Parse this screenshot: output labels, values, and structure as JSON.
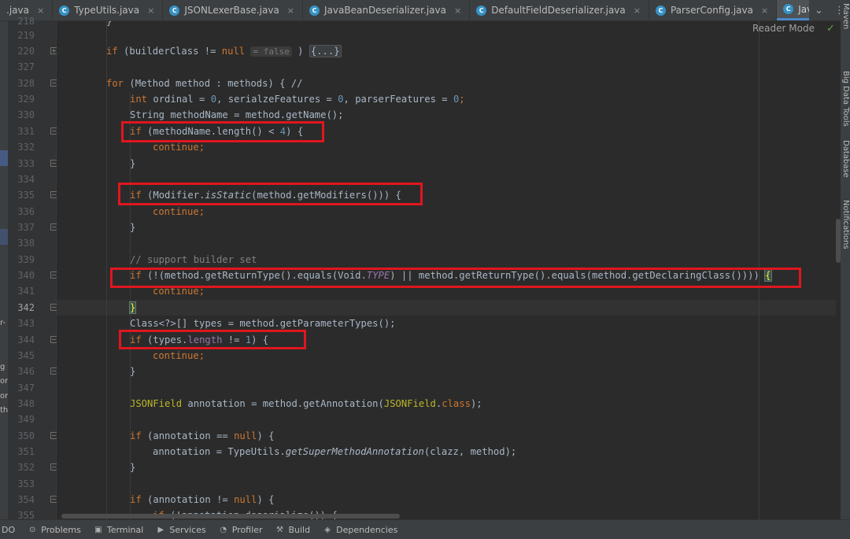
{
  "tabs": [
    {
      "label": ".java",
      "icon": false,
      "active": false
    },
    {
      "label": "TypeUtils.java",
      "icon": true,
      "active": false
    },
    {
      "label": "JSONLexerBase.java",
      "icon": true,
      "active": false
    },
    {
      "label": "JavaBeanDeserializer.java",
      "icon": true,
      "active": false
    },
    {
      "label": "DefaultFieldDeserializer.java",
      "icon": true,
      "active": false
    },
    {
      "label": "ParserConfig.java",
      "icon": true,
      "active": false
    },
    {
      "label": "JavaBeanInfo.java",
      "icon": true,
      "active": true
    }
  ],
  "tab_icon_letter": "C",
  "reader_mode_label": "Reader Mode",
  "line_numbers": [
    "218",
    "219",
    "220",
    "327",
    "328",
    "329",
    "330",
    "331",
    "332",
    "333",
    "334",
    "335",
    "336",
    "337",
    "338",
    "339",
    "340",
    "341",
    "342",
    "343",
    "344",
    "345",
    "346",
    "347",
    "348",
    "349",
    "350",
    "351",
    "352",
    "353",
    "354",
    "355"
  ],
  "current_line": "342",
  "code": {
    "l218": "}",
    "l220_a": "if",
    "l220_b": " (builderClass != ",
    "l220_c": "null",
    "l220_hint": "= false",
    "l220_d": " ) ",
    "l220_fold": "{...}",
    "l328_a": "for",
    "l328_b": " (Method method : methods) { //",
    "l329_a": "int",
    "l329_b": " ordinal = ",
    "l329_c": "0",
    "l329_d": ", serialzeFeatures = ",
    "l329_e": "0",
    "l329_f": ", parserFeatures = ",
    "l329_g": "0",
    "l329_h": ";",
    "l330": "String methodName = method.getName();",
    "l331_a": "if",
    "l331_b": " (methodName.length() < ",
    "l331_c": "4",
    "l331_d": ") {",
    "continue": "continue;",
    "close_brace": "}",
    "l335_a": "if",
    "l335_b": " (Modifier.",
    "l335_c": "isStatic",
    "l335_d": "(method.getModifiers())) {",
    "l339": "// support builder set",
    "l340_a": "if",
    "l340_b": " (!(method.getReturnType().equals(Void.",
    "l340_c": "TYPE",
    "l340_d": ") || method.getReturnType().equals(method.getDeclaringClass()))) ",
    "l340_e": "{",
    "l343": "Class<?>[] types = method.getParameterTypes();",
    "l344_a": "if",
    "l344_b": " (types.",
    "l344_c": "length",
    "l344_d": " != ",
    "l344_e": "1",
    "l344_f": ") {",
    "l348_a": "JSONField",
    "l348_b": " annotation = method.getAnnotation(",
    "l348_c": "JSONField",
    "l348_d": ".",
    "l348_e": "class",
    "l348_f": ");",
    "l350_a": "if",
    "l350_b": " (annotation == ",
    "l350_c": "null",
    "l350_d": ") {",
    "l351_a": "annotation = TypeUtils.",
    "l351_b": "getSuperMethodAnnotation",
    "l351_c": "(clazz, method);",
    "l354_a": "if",
    "l354_b": " (annotation != ",
    "l354_c": "null",
    "l354_d": ") {",
    "l355_a": "if",
    "l355_b": " (!annotation.deserialize()) {"
  },
  "left_fragments": [
    "r-",
    "g",
    "or",
    "or",
    "th"
  ],
  "right_tools": [
    "Maven",
    "Big Data Tools",
    "Database",
    "Notifications"
  ],
  "bottom_tools": [
    {
      "label": "DO",
      "icon": ""
    },
    {
      "label": "Problems",
      "icon": "problems-icon"
    },
    {
      "label": "Terminal",
      "icon": "terminal-icon"
    },
    {
      "label": "Services",
      "icon": "services-icon"
    },
    {
      "label": "Profiler",
      "icon": "profiler-icon"
    },
    {
      "label": "Build",
      "icon": "build-icon"
    },
    {
      "label": "Dependencies",
      "icon": "dependencies-icon"
    }
  ],
  "colors": {
    "highlight_box": "#e0161e",
    "keyword": "#cc7832",
    "number": "#6897bb"
  }
}
